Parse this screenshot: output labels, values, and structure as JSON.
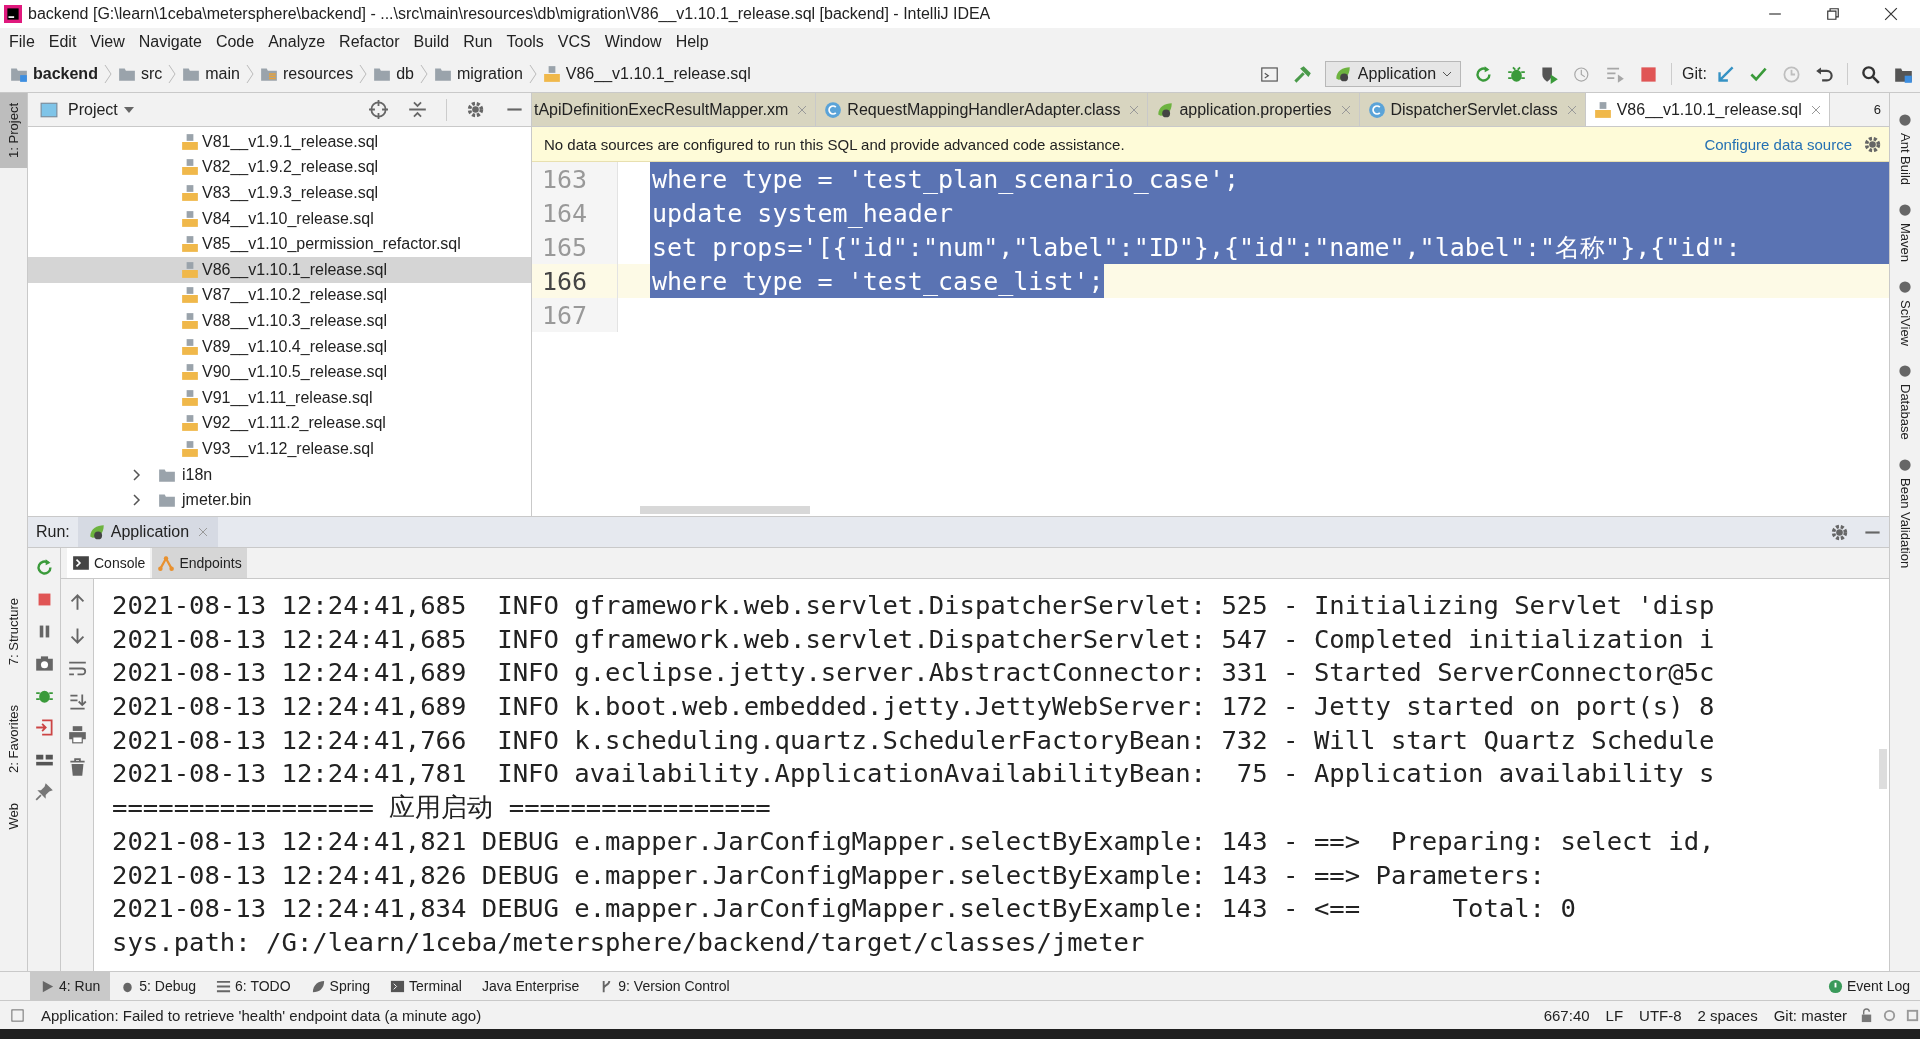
{
  "window": {
    "title": "backend [G:\\learn\\1ceba\\metersphere\\backend] - ...\\src\\main\\resources\\db\\migration\\V86__v1.10.1_release.sql [backend] - IntelliJ IDEA"
  },
  "menu": [
    "File",
    "Edit",
    "View",
    "Navigate",
    "Code",
    "Analyze",
    "Refactor",
    "Build",
    "Run",
    "Tools",
    "VCS",
    "Window",
    "Help"
  ],
  "breadcrumbs": [
    {
      "label": "backend",
      "kind": "module"
    },
    {
      "label": "src",
      "kind": "folder"
    },
    {
      "label": "main",
      "kind": "folder"
    },
    {
      "label": "resources",
      "kind": "resources"
    },
    {
      "label": "db",
      "kind": "folder"
    },
    {
      "label": "migration",
      "kind": "folder"
    },
    {
      "label": "V86__v1.10.1_release.sql",
      "kind": "sql"
    }
  ],
  "run_config": {
    "label": "Application"
  },
  "git_label": "Git:",
  "left_strip": [
    {
      "label": "1: Project",
      "selected": true
    },
    {
      "label": "7: Structure",
      "selected": false
    },
    {
      "label": "2: Favorites",
      "selected": false
    },
    {
      "label": "Web",
      "selected": false
    }
  ],
  "right_strip": [
    "Ant Build",
    "Maven",
    "SciView",
    "Database",
    "Bean Validation"
  ],
  "project": {
    "title": "Project",
    "items": [
      {
        "label": "V81__v1.9.1_release.sql",
        "kind": "sql",
        "selected": false
      },
      {
        "label": "V82__v1.9.2_release.sql",
        "kind": "sql",
        "selected": false
      },
      {
        "label": "V83__v1.9.3_release.sql",
        "kind": "sql",
        "selected": false
      },
      {
        "label": "V84__v1.10_release.sql",
        "kind": "sql",
        "selected": false
      },
      {
        "label": "V85__v1.10_permission_refactor.sql",
        "kind": "sql",
        "selected": false
      },
      {
        "label": "V86__v1.10.1_release.sql",
        "kind": "sql",
        "selected": true
      },
      {
        "label": "V87__v1.10.2_release.sql",
        "kind": "sql",
        "selected": false
      },
      {
        "label": "V88__v1.10.3_release.sql",
        "kind": "sql",
        "selected": false
      },
      {
        "label": "V89__v1.10.4_release.sql",
        "kind": "sql",
        "selected": false
      },
      {
        "label": "V90__v1.10.5_release.sql",
        "kind": "sql",
        "selected": false
      },
      {
        "label": "V91__v1.11_release.sql",
        "kind": "sql",
        "selected": false
      },
      {
        "label": "V92__v1.11.2_release.sql",
        "kind": "sql",
        "selected": false
      },
      {
        "label": "V93__v1.12_release.sql",
        "kind": "sql",
        "selected": false
      },
      {
        "label": "i18n",
        "kind": "folder",
        "selected": false
      },
      {
        "label": "jmeter.bin",
        "kind": "folder",
        "selected": false
      }
    ]
  },
  "editor_tabs": [
    {
      "label": "tApiDefinitionExecResultMapper.xm",
      "kind": "xml",
      "selected": false
    },
    {
      "label": "RequestMappingHandlerAdapter.class",
      "kind": "class",
      "selected": false
    },
    {
      "label": "application.properties",
      "kind": "properties",
      "selected": false
    },
    {
      "label": "DispatcherServlet.class",
      "kind": "class",
      "selected": false
    },
    {
      "label": "V86__v1.10.1_release.sql",
      "kind": "sql",
      "selected": true
    }
  ],
  "tab_count": "6",
  "banner": {
    "message": "No data sources are configured to run this SQL and provide advanced code assistance.",
    "link": "Configure data source"
  },
  "code_lines": [
    {
      "number": "163",
      "text": "where type = 'test_plan_scenario_case';",
      "selected": true,
      "current": false
    },
    {
      "number": "164",
      "text": "update system_header",
      "selected": true,
      "current": false
    },
    {
      "number": "165",
      "text": "set props='[{\"id\":\"num\",\"label\":\"ID\"},{\"id\":\"name\",\"label\":\"名称\"},{\"id\":",
      "selected": true,
      "current": false
    },
    {
      "number": "166",
      "text": "where type = 'test_case_list';",
      "selected": true,
      "current": true
    },
    {
      "number": "167"
    }
  ],
  "run": {
    "label": "Run:",
    "tab": "Application",
    "subtabs": [
      {
        "label": "Console",
        "kind": "console",
        "selected": true
      },
      {
        "label": "Endpoints",
        "kind": "endpoints",
        "selected": false
      }
    ],
    "log": [
      "2021-08-13 12:24:41,685  INFO gframework.web.servlet.DispatcherServlet: 525 - Initializing Servlet 'disp",
      "2021-08-13 12:24:41,685  INFO gframework.web.servlet.DispatcherServlet: 547 - Completed initialization i",
      "2021-08-13 12:24:41,689  INFO g.eclipse.jetty.server.AbstractConnector: 331 - Started ServerConnector@5c",
      "2021-08-13 12:24:41,689  INFO k.boot.web.embedded.jetty.JettyWebServer: 172 - Jetty started on port(s) 8",
      "2021-08-13 12:24:41,766  INFO k.scheduling.quartz.SchedulerFactoryBean: 732 - Will start Quartz Schedule",
      "2021-08-13 12:24:41,781  INFO availability.ApplicationAvailabilityBean:  75 - Application availability s",
      "================= 应用启动 =================",
      "2021-08-13 12:24:41,821 DEBUG e.mapper.JarConfigMapper.selectByExample: 143 - ==>  Preparing: select id,",
      "2021-08-13 12:24:41,826 DEBUG e.mapper.JarConfigMapper.selectByExample: 143 - ==> Parameters:",
      "2021-08-13 12:24:41,834 DEBUG e.mapper.JarConfigMapper.selectByExample: 143 - <==      Total: 0",
      "sys.path: /G:/learn/1ceba/metersphere/backend/target/classes/jmeter"
    ]
  },
  "tool_tabs": [
    {
      "label": "4: Run",
      "kind": "run",
      "selected": true
    },
    {
      "label": "5: Debug",
      "kind": "debug",
      "selected": false
    },
    {
      "label": "6: TODO",
      "kind": "todo",
      "selected": false
    },
    {
      "label": "Spring",
      "kind": "spring",
      "selected": false
    },
    {
      "label": "Terminal",
      "kind": "terminal",
      "selected": false
    },
    {
      "label": "Java Enterprise",
      "kind": "plain",
      "selected": false
    },
    {
      "label": "9: Version Control",
      "kind": "vcs",
      "selected": false
    }
  ],
  "event_log": "Event Log",
  "status_bar": {
    "message": "Application: Failed to retrieve 'health' endpoint data (a minute ago)",
    "items": [
      "667:40",
      "LF",
      "UTF-8",
      "2 spaces",
      "Git: master"
    ]
  }
}
